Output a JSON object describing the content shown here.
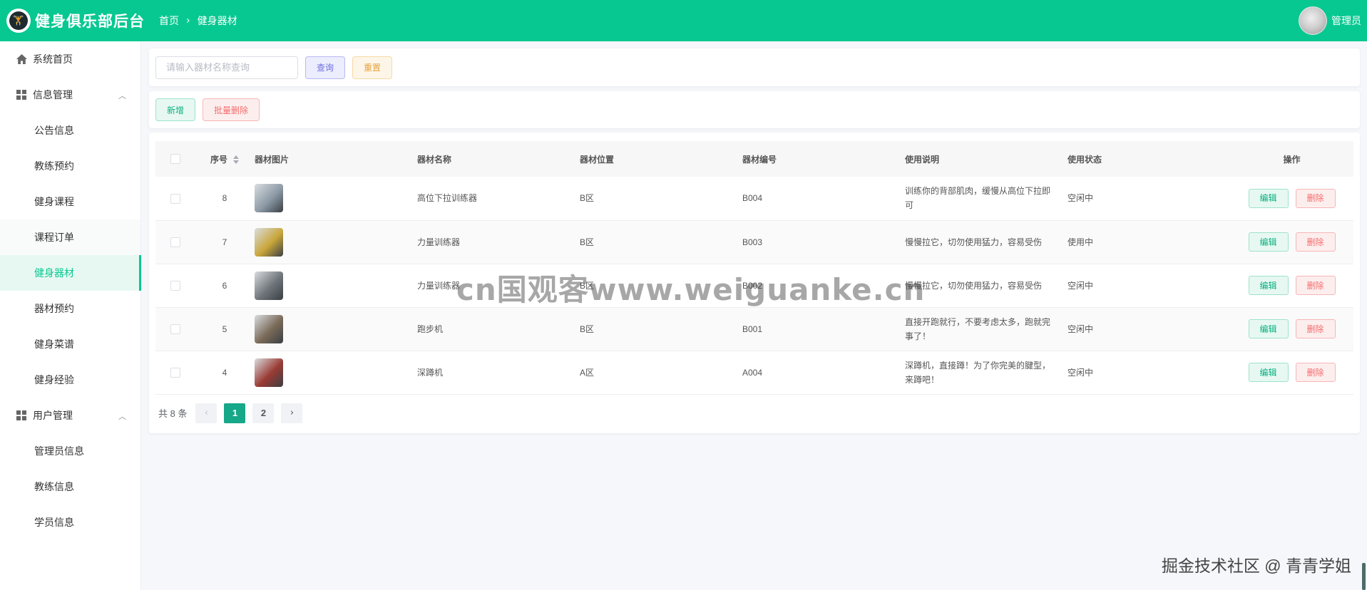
{
  "header": {
    "title": "健身俱乐部后台",
    "logo_icon": "gym-logo-icon",
    "breadcrumb": [
      "首页",
      "健身器材"
    ],
    "user_name": "管理员",
    "brand_color": "#07c891"
  },
  "sidebar": {
    "items": [
      {
        "label": "系统首页",
        "level": "top",
        "icon": "home-icon"
      },
      {
        "label": "信息管理",
        "level": "top",
        "icon": "grid-icon",
        "expanded": true
      },
      {
        "label": "公告信息",
        "level": "sub"
      },
      {
        "label": "教练预约",
        "level": "sub"
      },
      {
        "label": "健身课程",
        "level": "sub"
      },
      {
        "label": "课程订单",
        "level": "sub"
      },
      {
        "label": "健身器材",
        "level": "sub",
        "active": true
      },
      {
        "label": "器材预约",
        "level": "sub"
      },
      {
        "label": "健身菜谱",
        "level": "sub"
      },
      {
        "label": "健身经验",
        "level": "sub"
      },
      {
        "label": "用户管理",
        "level": "top",
        "icon": "grid-icon",
        "expanded": true
      },
      {
        "label": "管理员信息",
        "level": "sub"
      },
      {
        "label": "教练信息",
        "level": "sub"
      },
      {
        "label": "学员信息",
        "level": "sub"
      }
    ]
  },
  "search": {
    "placeholder": "请输入器材名称查询",
    "value": "",
    "query_label": "查询",
    "reset_label": "重置"
  },
  "actions": {
    "add_label": "新增",
    "batch_delete_label": "批量删除"
  },
  "table": {
    "columns": [
      "序号",
      "器材图片",
      "器材名称",
      "器材位置",
      "器材编号",
      "使用说明",
      "使用状态",
      "操作"
    ],
    "rows": [
      {
        "id": "8",
        "name": "高位下拉训练器",
        "location": "B区",
        "code": "B004",
        "desc": "训练你的背部肌肉，缓慢从高位下拉即可",
        "status": "空闲中",
        "thumb": "#8c9aa6"
      },
      {
        "id": "7",
        "name": "力量训练器",
        "location": "B区",
        "code": "B003",
        "desc": "慢慢拉它，切勿使用猛力，容易受伤",
        "status": "使用中",
        "thumb": "#c9a63a"
      },
      {
        "id": "6",
        "name": "力量训练器",
        "location": "B区",
        "code": "B002",
        "desc": "慢慢拉它，切勿使用猛力，容易受伤",
        "status": "空闲中",
        "thumb": "#6e7479"
      },
      {
        "id": "5",
        "name": "跑步机",
        "location": "B区",
        "code": "B001",
        "desc": "直接开跑就行，不要考虑太多，跑就完事了！",
        "status": "空闲中",
        "thumb": "#7a6a58"
      },
      {
        "id": "4",
        "name": "深蹲机",
        "location": "A区",
        "code": "A004",
        "desc": "深蹲机，直接蹲！为了你完美的腱型，来蹲吧！",
        "status": "空闲中",
        "thumb": "#9a3b34"
      }
    ],
    "edit_label": "编辑",
    "delete_label": "删除"
  },
  "pagination": {
    "total_text": "共 8 条",
    "pages": [
      "1",
      "2"
    ],
    "current": "1"
  },
  "watermarks": {
    "center": "cn国观客www.weiguanke.cn",
    "bottom_right": "掘金技术社区 @ 青青学姐"
  }
}
